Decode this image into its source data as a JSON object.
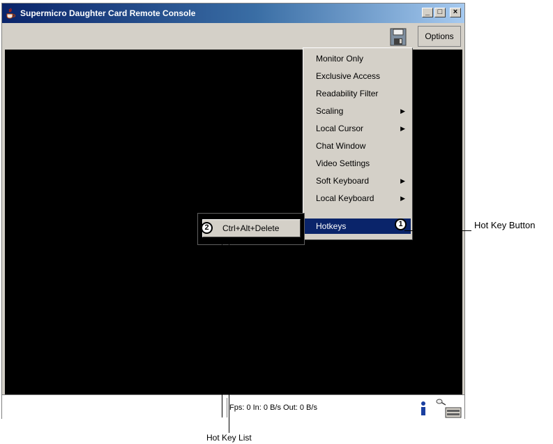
{
  "window": {
    "title": "Supermicro Daughter Card Remote Console",
    "controls": {
      "minimize": "_",
      "maximize": "□",
      "close": "×"
    }
  },
  "toolbar": {
    "options_label": "Options",
    "save_icon": "floppy-disk-icon"
  },
  "options_menu": {
    "items": [
      {
        "label": "Monitor Only",
        "submenu": false
      },
      {
        "label": "Exclusive Access",
        "submenu": false
      },
      {
        "label": "Readability Filter",
        "submenu": false
      },
      {
        "label": "Scaling",
        "submenu": true
      },
      {
        "label": "Local Cursor",
        "submenu": true
      },
      {
        "label": "Chat Window",
        "submenu": false
      },
      {
        "label": "Video Settings",
        "submenu": false
      },
      {
        "label": "Soft Keyboard",
        "submenu": true
      },
      {
        "label": "Local Keyboard",
        "submenu": true
      },
      {
        "label": "Hotkeys",
        "submenu": false,
        "selected": true
      }
    ],
    "arrow": "▶"
  },
  "hotkey_list": {
    "items": [
      "Ctrl+Alt+Delete"
    ]
  },
  "status": {
    "text": "Fps: 0 In: 0 B/s Out: 0 B/s"
  },
  "annotations": {
    "badge1": "1",
    "badge2": "2",
    "hot_key_button": "Hot Key Button",
    "hot_key_list": "Hot Key List"
  },
  "colors": {
    "selection": "#0a246a",
    "screen": "#000000",
    "chrome": "#d4d0c8"
  }
}
